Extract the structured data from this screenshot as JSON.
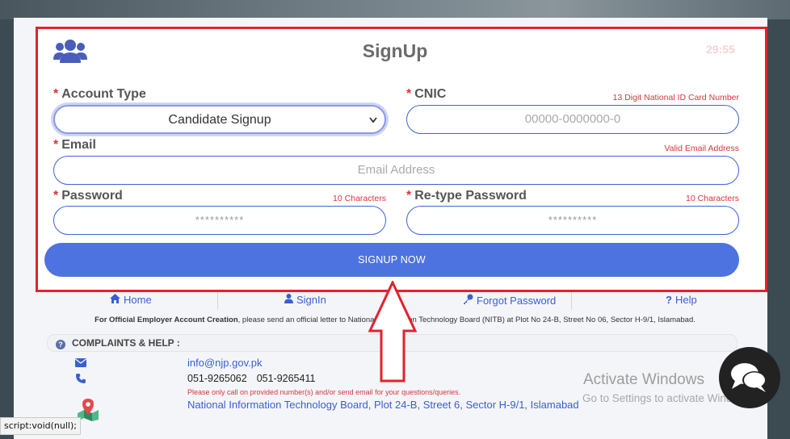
{
  "form": {
    "title": "SignUp",
    "timer": "29:55",
    "account_type": {
      "label": "Account Type",
      "value": "Candidate Signup"
    },
    "cnic": {
      "label": "CNIC",
      "hint": "13 Digit National ID Card Number",
      "placeholder": "00000-0000000-0"
    },
    "email": {
      "label": "Email",
      "hint": "Valid Email Address",
      "placeholder": "Email Address"
    },
    "password": {
      "label": "Password",
      "hint": "10 Characters",
      "placeholder": "**********"
    },
    "retype_password": {
      "label": "Re-type Password",
      "hint": "10 Characters",
      "placeholder": "**********"
    },
    "required_marker": "*",
    "submit_label": "SIGNUP NOW"
  },
  "nav": {
    "home": "Home",
    "signin": "SignIn",
    "forgot": "Forgot Password",
    "help": "Help"
  },
  "notice": {
    "bold": "For Official Employer Account Creation",
    "text": ", please send an official letter to National Information Technology Board (NITB) at Plot No 24-B, Street No 06, Sector H-9/1, Islamabad."
  },
  "complaints": {
    "heading": "COMPLAINTS & HELP :",
    "email": "info@njp.gov.pk",
    "phone1": "051-9265062",
    "phone2": "051-9265411",
    "call_note": "Please only call on provided number(s) and/or send email for your questions/queries.",
    "address": "National Information Technology Board, Plot 24-B, Street 6, Sector H-9/1, Islamabad"
  },
  "overlay": {
    "activate_title": "Activate Windows",
    "activate_sub": "Go to Settings to activate Windows.",
    "status_url": "script:void(null);"
  },
  "colors": {
    "accent": "#4c73e0",
    "link": "#3a5fd0",
    "required": "#d9363e",
    "highlight_box": "#e2222c"
  },
  "icons": [
    "users-icon",
    "home-icon",
    "user-icon",
    "key-icon",
    "question-icon",
    "envelope-icon",
    "phone-icon",
    "map-marker-icon",
    "chat-icon"
  ]
}
